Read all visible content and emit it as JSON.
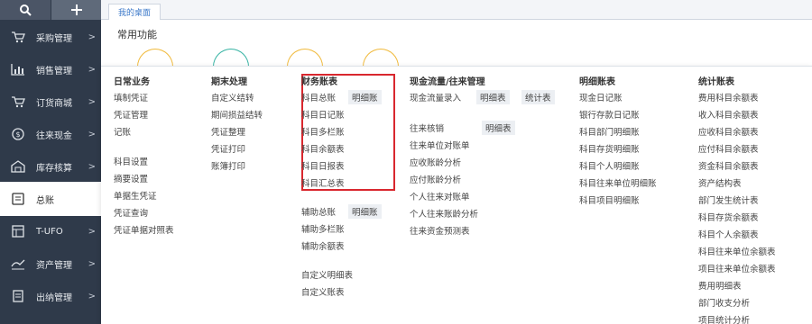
{
  "topbar": {
    "search_icon": "search-icon",
    "add_icon": "plus-icon"
  },
  "sidebar": {
    "items": [
      {
        "label": "采购管理",
        "icon": "cart-icon"
      },
      {
        "label": "销售管理",
        "icon": "chart-icon"
      },
      {
        "label": "订货商城",
        "icon": "shop-cart-icon"
      },
      {
        "label": "往来现金",
        "icon": "coin-icon"
      },
      {
        "label": "库存核算",
        "icon": "warehouse-icon"
      },
      {
        "label": "总账",
        "icon": "ledger-icon"
      },
      {
        "label": "T-UFO",
        "icon": "report-icon"
      },
      {
        "label": "资产管理",
        "icon": "asset-icon"
      },
      {
        "label": "出纳管理",
        "icon": "cashier-icon"
      }
    ],
    "active_index": 5,
    "chevron": ">"
  },
  "tabs": {
    "home": "我的桌面"
  },
  "main": {
    "section_title": "常用功能"
  },
  "panel": {
    "columns": [
      {
        "head": "日常业务",
        "items": [
          "填制凭证",
          "凭证管理",
          "记账",
          "科目设置",
          "摘要设置",
          "单据生凭证",
          "凭证查询",
          "凭证单据对照表"
        ]
      },
      {
        "head": "期末处理",
        "items": [
          "自定义结转",
          "期间损益结转",
          "凭证整理",
          "凭证打印",
          "账簿打印"
        ]
      },
      {
        "head": "财务账表",
        "items": [
          "科目总账",
          "科目日记账",
          "科目多栏账",
          "科目余额表",
          "科目日报表",
          "科目汇总表",
          "辅助总账",
          "辅助多栏账",
          "辅助余额表",
          "自定义明细表",
          "自定义账表"
        ],
        "chips": [
          "明细账",
          "明细账"
        ]
      },
      {
        "head": "现金流量/往来管理",
        "items": [
          "现金流量录入",
          "往来核销",
          "往来单位对账单",
          "应收账龄分析",
          "应付账龄分析",
          "个人往来对账单",
          "个人往来账龄分析",
          "往来资金预测表"
        ],
        "chips": [
          "明细表",
          "统计表",
          "明细表"
        ]
      },
      {
        "head": "明细账表",
        "items": [
          "现金日记账",
          "银行存款日记账",
          "科目部门明细账",
          "科目存货明细账",
          "科目个人明细账",
          "科目往来单位明细账",
          "科目项目明细账"
        ]
      },
      {
        "head": "统计账表",
        "items": [
          "费用科目余额表",
          "收入科目余额表",
          "应收科目余额表",
          "应付科目余额表",
          "资金科目余额表",
          "资产结构表",
          "部门发生统计表",
          "科目存货余额表",
          "科目个人余额表",
          "科目往来单位余额表",
          "项目往来单位余额表",
          "费用明细表",
          "部门收支分析",
          "项目统计分析"
        ]
      }
    ]
  },
  "colors": {
    "sidebar_bg": "#2f3a4a",
    "highlight_border": "#d9272e",
    "tab_text": "#3b78c9"
  }
}
